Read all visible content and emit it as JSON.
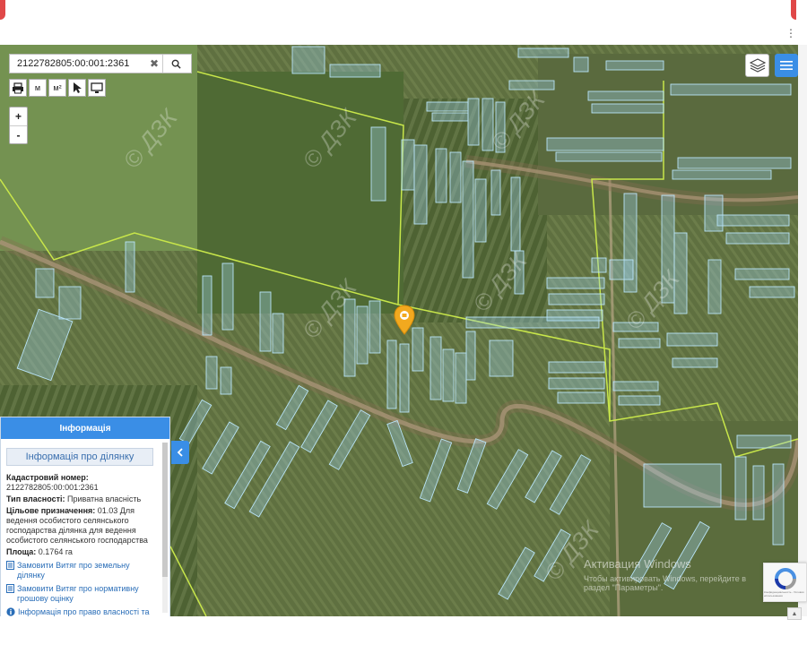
{
  "search": {
    "value": "2122782805:00:001:2361"
  },
  "toolbar": {
    "print": "print-icon",
    "measure_length_label": "м",
    "measure_area_label": "м²",
    "select": "cursor-icon",
    "screen": "monitor-icon"
  },
  "zoom": {
    "in_label": "+",
    "out_label": "-"
  },
  "map": {
    "watermark_text": "© ДЗК"
  },
  "panel": {
    "header": "Інформація",
    "subheader": "Інформація про ділянку",
    "cadastral_label": "Кадастровий номер:",
    "cadastral_value": "2122782805:00:001:2361",
    "ownership_label": "Тип власності:",
    "ownership_value": "Приватна власність",
    "purpose_label": "Цільове призначення:",
    "purpose_value": "01.03 Для ведення особистого селянського господарства ділянка для ведення особистого селянського господарства",
    "area_label": "Площа:",
    "area_value": "0.1764 га",
    "links": [
      "Замовити Витяг про земельну ділянку",
      "Замовити Витяг про нормативну грошову оцінку",
      "Інформація про право власності та"
    ]
  },
  "windows_activation": {
    "title": "Активация Windows",
    "line1": "Чтобы активировать Windows, перейдите в",
    "line2": "раздел \"Параметры\"."
  },
  "recaptcha": {
    "small_text": "Конфиденциальность - Условия использования"
  },
  "colors": {
    "accent": "#3a8ee6",
    "boundary": "#c8e64a",
    "parcel": "#9fd2ee"
  }
}
